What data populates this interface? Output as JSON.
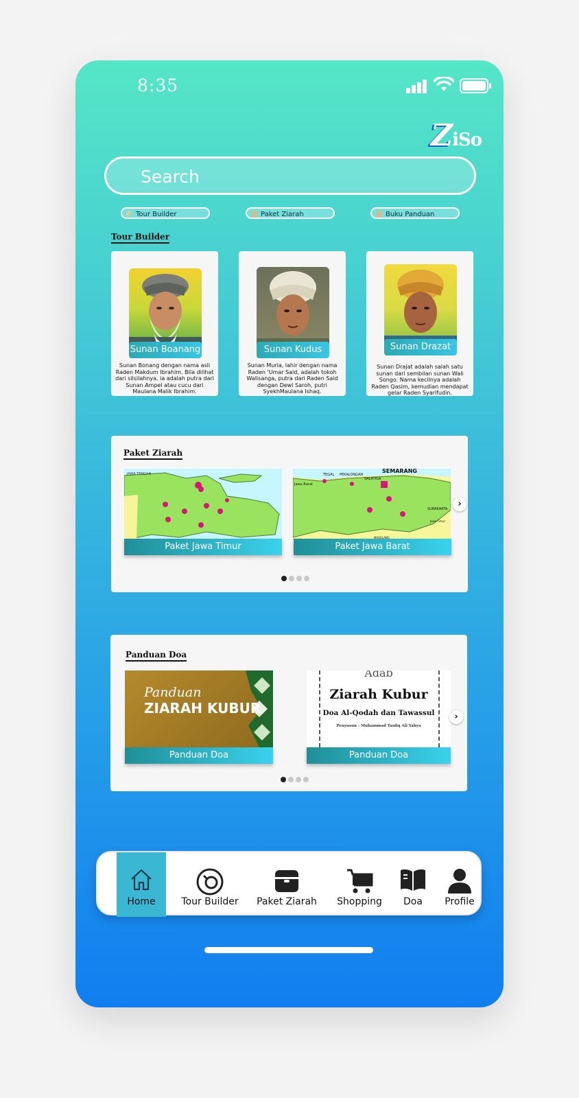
{
  "status": {
    "time": "8:35"
  },
  "app": {
    "logo_z": "Z",
    "logo_rest": "iSo"
  },
  "search": {
    "label": "Search"
  },
  "chips": [
    "Tour Builder",
    "Paket Ziarah",
    "Buku Panduan"
  ],
  "tour_builder": {
    "title": "Tour Builder",
    "cards": [
      {
        "name": "Sunan Boanang",
        "desc": "Sunan Bonang dengan nama asli Raden Makdum Ibrahim. Bila dilihat dari silsilahnya, ia adalah putra dari Sunan Ampel atau cucu dari Maulana Malik Ibrahim."
      },
      {
        "name": "Sunan Kudus",
        "desc": "Sunan Muria, lahir dengan nama Raden 'Umar Said, adalah tokoh Walisanga, putra dari Raden Said dengan Dewi Saroh, putri SyekhMaulana Ishaq."
      },
      {
        "name": "Sunan Drazat",
        "desc": "Sunan Drajat adalah salah satu sunan dari sembilan sunan Wali Songo. Nama kecilnya adalah Raden Qasim, kemudian mendapat gelar Raden Syarifudin."
      }
    ]
  },
  "paket_ziarah": {
    "title": "Paket Ziarah",
    "items": [
      {
        "caption": "Paket Jawa Timur",
        "map_labels": [
          "JAWA TENGAH"
        ]
      },
      {
        "caption": "Paket Jawa Barat",
        "map_labels": [
          "SEMARANG",
          "TEGAL",
          "PEKALONGAN",
          "SALATIGA",
          "SURAKARTA",
          "Jawa Barat",
          "Jawa Timur",
          "MAGELANG"
        ]
      }
    ],
    "next": "›"
  },
  "panduan_doa": {
    "title": "Panduan Doa",
    "items": [
      {
        "caption": "Panduan Doa",
        "cover_line1": "Panduan",
        "cover_line2": "ZIARAH KUBUR"
      },
      {
        "caption": "Panduan Doa",
        "cover_top": "Adab",
        "cover_title": "Ziarah Kubur",
        "cover_sub": "Doa Al-Qodah dan Tawassul",
        "cover_author": "Penyusun : Muhammad Taufiq Ali Yahya"
      }
    ],
    "next": "›"
  },
  "nav": {
    "items": [
      {
        "label": "Home",
        "icon": "home-icon",
        "active": true
      },
      {
        "label": "Tour Builder",
        "icon": "tour-builder-icon"
      },
      {
        "label": "Paket Ziarah",
        "icon": "package-icon"
      },
      {
        "label": "Shopping",
        "icon": "cart-icon"
      },
      {
        "label": "Doa",
        "icon": "book-icon"
      },
      {
        "label": "Profile",
        "icon": "profile-icon"
      }
    ]
  },
  "colors": {
    "gradient_top": "#55e6c6",
    "gradient_bottom": "#117ef0",
    "accent": "#39b7d3"
  }
}
